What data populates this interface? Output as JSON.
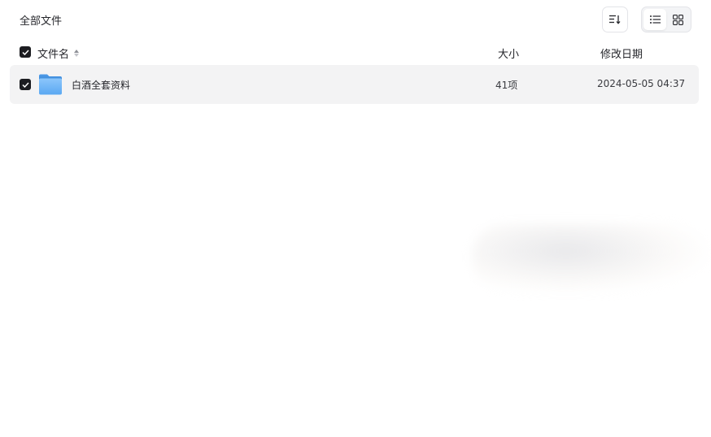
{
  "breadcrumb": {
    "title": "全部文件"
  },
  "toolbar": {
    "sort_icon": "sort-list-icon",
    "view_list_icon": "list-view-icon",
    "view_grid_icon": "grid-view-icon",
    "active_view": "list"
  },
  "columns": {
    "name": "文件名",
    "size": "大小",
    "date": "修改日期"
  },
  "files": [
    {
      "name": "白酒全套资料",
      "type": "folder",
      "size": "41项",
      "modified": "2024-05-05 04:37",
      "checked": true
    }
  ],
  "colors": {
    "row_bg": "#f3f3f4",
    "checkbox": "#1c1d21",
    "folder": "#6fb3f5"
  }
}
